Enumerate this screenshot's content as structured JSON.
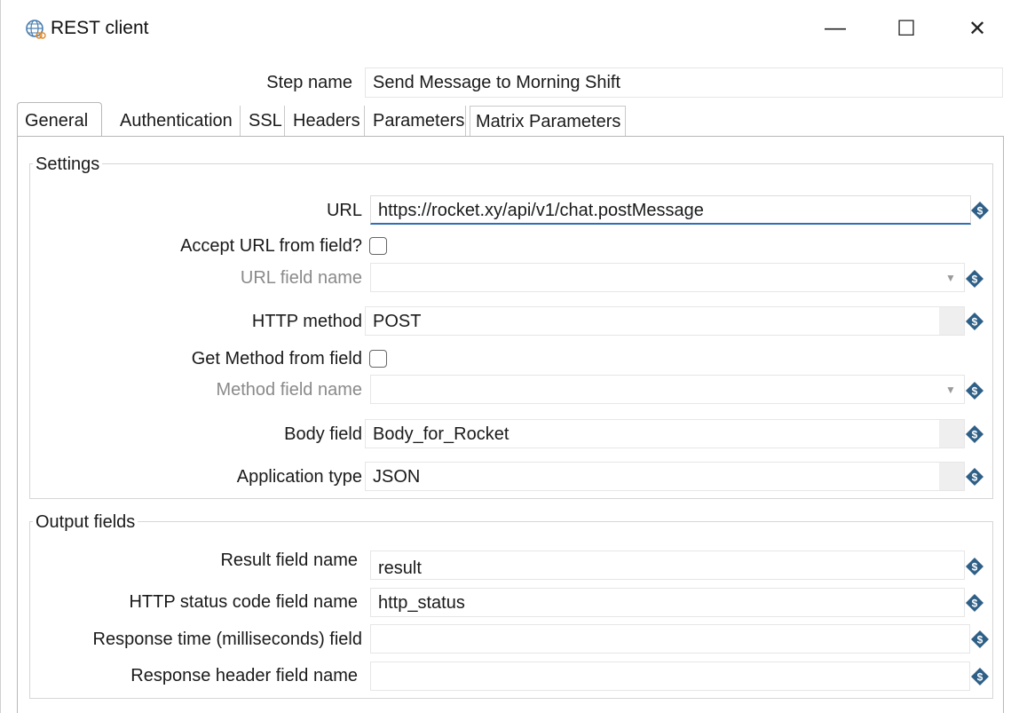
{
  "window": {
    "title": "REST client",
    "icon": "rest-client-globe-icon",
    "controls": {
      "minimize": "—",
      "maximize": "☐",
      "close": "✕"
    }
  },
  "step_name": {
    "label": "Step name",
    "value": "Send Message to Morning Shift"
  },
  "tabs": [
    {
      "label": "General",
      "active": true
    },
    {
      "label": "Authentication",
      "active": false
    },
    {
      "label": "SSL",
      "active": false
    },
    {
      "label": "Headers",
      "active": false
    },
    {
      "label": "Parameters",
      "active": false
    },
    {
      "label": "Matrix Parameters",
      "active": false
    }
  ],
  "settings": {
    "title": "Settings",
    "url": {
      "label": "URL",
      "value": "https://rocket.xy/api/v1/chat.postMessage"
    },
    "accept_url_from_field": {
      "label": "Accept URL from field?",
      "checked": false
    },
    "url_field_name": {
      "label": "URL field name",
      "value": ""
    },
    "http_method": {
      "label": "HTTP method",
      "value": "POST"
    },
    "get_method_from_field": {
      "label": "Get Method from field",
      "checked": false
    },
    "method_field_name": {
      "label": "Method field name",
      "value": ""
    },
    "body_field": {
      "label": "Body field",
      "value": "Body_for_Rocket"
    },
    "application_type": {
      "label": "Application type",
      "value": "JSON"
    }
  },
  "output_fields": {
    "title": "Output fields",
    "result_field_name": {
      "label": "Result field name",
      "value": "result"
    },
    "http_status_code_field_name": {
      "label": "HTTP status code field name",
      "value": "http_status"
    },
    "response_time_field": {
      "label": "Response time (milliseconds) field",
      "value": ""
    },
    "response_header_field_name": {
      "label": "Response header field name",
      "value": ""
    }
  },
  "colors": {
    "focus_underline": "#2f6fb3",
    "variable_icon": "#2e5f86",
    "dim_label": "#8a8a8a"
  }
}
